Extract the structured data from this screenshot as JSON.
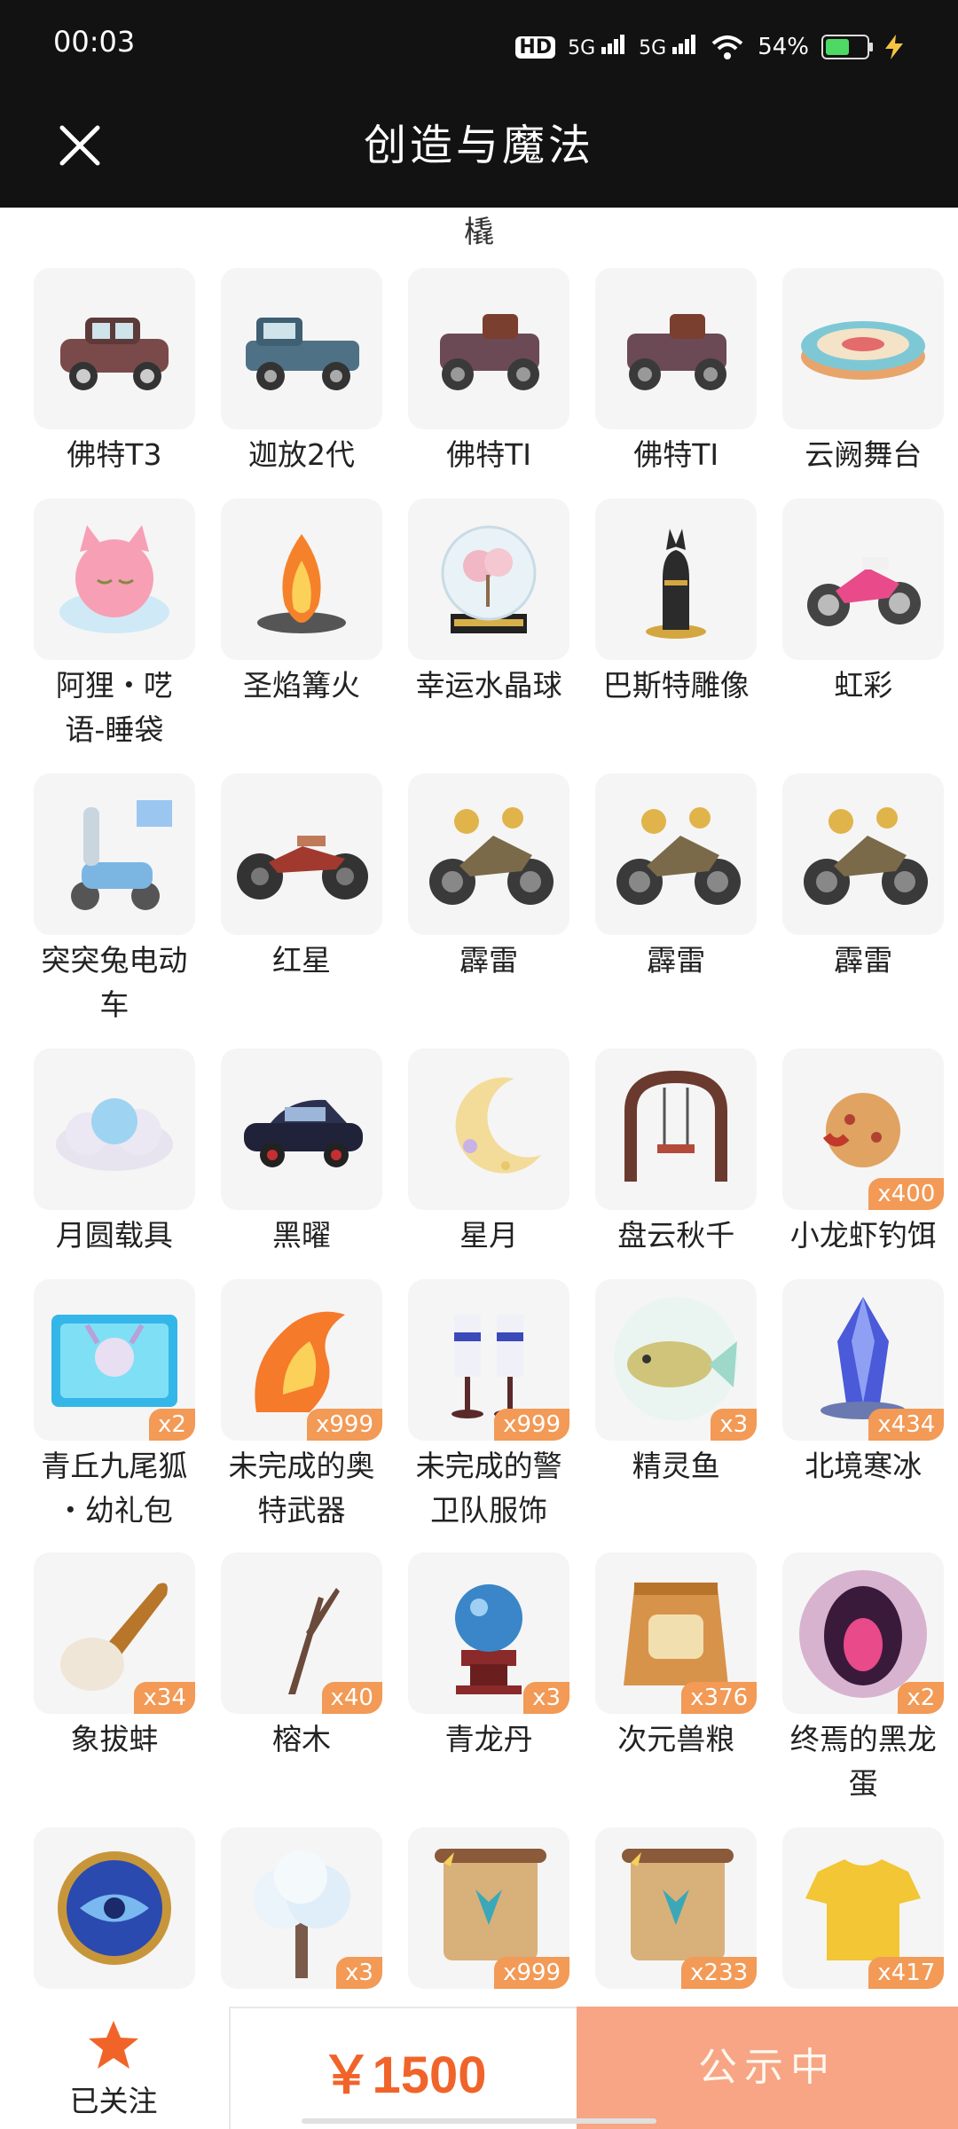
{
  "status_bar": {
    "time": "00:03",
    "hd_label": "HD",
    "signal1": "5G",
    "signal2": "5G",
    "battery": "54%"
  },
  "header": {
    "title": "创造与魔法",
    "close_icon": "close-icon"
  },
  "content": {
    "cut_off_text": "橇",
    "rows": [
      [
        {
          "name": "佛特T3",
          "icon": "vintage-car"
        },
        {
          "name": "迦放2代",
          "icon": "pickup-truck"
        },
        {
          "name": "佛特TI",
          "icon": "old-car"
        },
        {
          "name": "佛特TI",
          "icon": "old-car"
        },
        {
          "name": "云阙舞台",
          "icon": "stage-disc"
        }
      ],
      [
        {
          "name": "阿狸·呓语-睡袋",
          "icon": "fox-sleeping-bag",
          "lines": [
            "阿狸・呓",
            "语-睡袋"
          ]
        },
        {
          "name": "圣焰篝火",
          "icon": "bonfire"
        },
        {
          "name": "幸运水晶球",
          "icon": "crystal-ball"
        },
        {
          "name": "巴斯特雕像",
          "icon": "cat-statue"
        },
        {
          "name": "虹彩",
          "icon": "motorcycle"
        }
      ],
      [
        {
          "name": "突突兔电动车",
          "icon": "scooter",
          "lines": [
            "突突兔电动",
            "车"
          ]
        },
        {
          "name": "红星",
          "icon": "chopper"
        },
        {
          "name": "霹雷",
          "icon": "motorcycle-gold"
        },
        {
          "name": "霹雷",
          "icon": "motorcycle-gold"
        },
        {
          "name": "霹雷",
          "icon": "motorcycle-gold"
        }
      ],
      [
        {
          "name": "月圆载具",
          "icon": "cloud-moon"
        },
        {
          "name": "黑曜",
          "icon": "black-car"
        },
        {
          "name": "星月",
          "icon": "crescent-moon"
        },
        {
          "name": "盘云秋千",
          "icon": "swing"
        },
        {
          "name": "小龙虾钓饵",
          "icon": "bait",
          "count": "x400"
        }
      ],
      [
        {
          "name": "青丘九尾狐·幼礼包",
          "icon": "gift-box",
          "count": "x2",
          "lines": [
            "青丘九尾狐",
            "・幼礼包"
          ]
        },
        {
          "name": "未完成的奥特武器",
          "icon": "fire-weapon",
          "count": "x999",
          "lines": [
            "未完成的奥",
            "特武器"
          ]
        },
        {
          "name": "未完成的警卫队服饰",
          "icon": "uniform-stand",
          "count": "x999",
          "lines": [
            "未完成的警",
            "卫队服饰"
          ]
        },
        {
          "name": "精灵鱼",
          "icon": "fish",
          "count": "x3"
        },
        {
          "name": "北境寒冰",
          "icon": "ice-crystal",
          "count": "x434"
        }
      ],
      [
        {
          "name": "象拔蚌",
          "icon": "clam",
          "count": "x34"
        },
        {
          "name": "榕木",
          "icon": "branch",
          "count": "x40"
        },
        {
          "name": "青龙丹",
          "icon": "orb-pedestal",
          "count": "x3"
        },
        {
          "name": "次元兽粮",
          "icon": "food-bag",
          "count": "x376"
        },
        {
          "name": "终焉的黑龙蛋",
          "icon": "dark-egg",
          "count": "x2",
          "lines": [
            "终焉的黑龙",
            "蛋"
          ]
        }
      ],
      [
        {
          "name": "",
          "icon": "eye-coin"
        },
        {
          "name": "",
          "icon": "snow-tree",
          "count": "x3"
        },
        {
          "name": "",
          "icon": "scroll",
          "count": "x999"
        },
        {
          "name": "",
          "icon": "scroll",
          "count": "x233"
        },
        {
          "name": "",
          "icon": "yellow-shirt",
          "count": "x417"
        }
      ]
    ]
  },
  "bottom_bar": {
    "follow_label": "已关注",
    "price": "￥1500",
    "status_button": "公示中"
  },
  "colors": {
    "accent": "#f29a56",
    "price": "#f0642a",
    "status_button": "#f7a584",
    "header_bg": "#121212"
  }
}
